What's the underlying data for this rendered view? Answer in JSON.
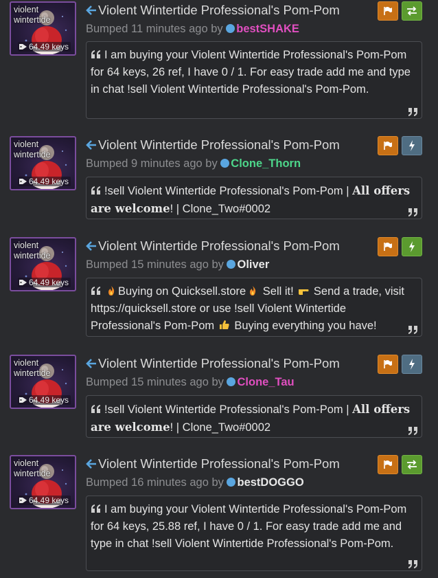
{
  "colors": {
    "background": "#2a2b2e",
    "flag_button": "#c77015",
    "trade_button": "#5b9b2f",
    "bolt_button_blue": "#4f6d82",
    "bolt_button_green": "#5b9b2f",
    "user_online_dot": "#5aa6e0",
    "item_border_unusual": "#7b4d9e"
  },
  "listings": [
    {
      "item_name": "violent wintertide",
      "item_price": "64.49 keys",
      "title": "Violent Wintertide Professional's Pom-Pom",
      "bumped": "Bumped 11 minutes ago by",
      "user": "bestSHAKE",
      "user_color": "#e04fc0",
      "action_icon": "trade-icon",
      "message": "I am buying your Violent Wintertide Professional's Pom-Pom for 64 keys, 26 ref, I have 0 / 1. For easy trade add me and type in chat !sell Violent Wintertide Professional's Pom-Pom."
    },
    {
      "item_name": "violent wintertide",
      "item_price": "64.49 keys",
      "title": "Violent Wintertide Professional's Pom-Pom",
      "bumped": "Bumped 9 minutes ago by",
      "user": "Clone_Thorn",
      "user_color": "#4dd68a",
      "action_icon": "lightning-icon",
      "message_a": "!sell Violent Wintertide Professional's Pom-Pom | ",
      "message_bold": "All offers are welcome",
      "message_b": "! | Clone_Two#0002"
    },
    {
      "item_name": "violent wintertide",
      "item_price": "64.49 keys",
      "title": "Violent Wintertide Professional's Pom-Pom",
      "bumped": "Bumped 15 minutes ago by",
      "user": "Oliver",
      "user_color": "#e8e8e8",
      "action_icon": "lightning-icon",
      "message_a": "Buying on Quicksell.store",
      "message_b": "Sell it!",
      "message_c": "Send a trade, visit https://quicksell.store or use !sell Violent Wintertide Professional's Pom-Pom",
      "message_d": "Buying everything you have!"
    },
    {
      "item_name": "violent wintertide",
      "item_price": "64.49 keys",
      "title": "Violent Wintertide Professional's Pom-Pom",
      "bumped": "Bumped 15 minutes ago by",
      "user": "Clone_Tau",
      "user_color": "#e04fc0",
      "action_icon": "lightning-icon",
      "message_a": "!sell Violent Wintertide Professional's Pom-Pom | ",
      "message_bold": "All offers are welcome",
      "message_b": "! | Clone_Two#0002"
    },
    {
      "item_name": "violent wintertide",
      "item_price": "64.49 keys",
      "title": "Violent Wintertide Professional's Pom-Pom",
      "bumped": "Bumped 16 minutes ago by",
      "user": "bestDOGGO",
      "user_color": "#e8e8e8",
      "action_icon": "trade-icon",
      "message": "I am buying your Violent Wintertide Professional's Pom-Pom for 64 keys, 25.88 ref, I have 0 / 1. For easy trade add me and type in chat !sell Violent Wintertide Professional's Pom-Pom."
    }
  ]
}
